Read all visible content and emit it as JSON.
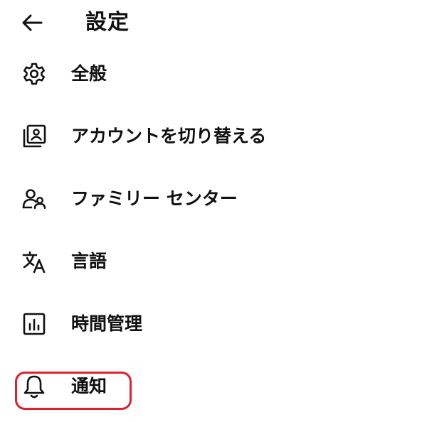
{
  "header": {
    "back_icon": "arrow-left-icon",
    "title": "設定"
  },
  "menu": {
    "items": [
      {
        "label": "全般",
        "icon": "gear-icon"
      },
      {
        "label": "アカウントを切り替える",
        "icon": "switch-account-icon"
      },
      {
        "label": "ファミリー センター",
        "icon": "family-icon"
      },
      {
        "label": "言語",
        "icon": "translate-icon"
      },
      {
        "label": "時間管理",
        "icon": "bar-chart-icon"
      },
      {
        "label": "通知",
        "icon": "bell-icon",
        "highlighted": true
      }
    ]
  },
  "colors": {
    "text": "#111111",
    "highlight": "#e0202f",
    "background": "#ffffff"
  }
}
